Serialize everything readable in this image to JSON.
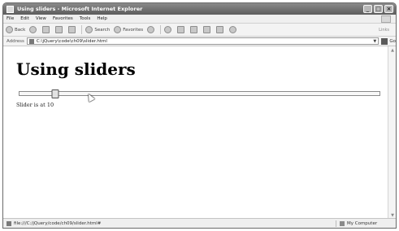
{
  "window": {
    "title": "Using sliders - Microsoft Internet Explorer",
    "controls": {
      "minimize": "_",
      "maximize": "□",
      "close": "×"
    }
  },
  "menu": {
    "items": [
      "File",
      "Edit",
      "View",
      "Favorites",
      "Tools",
      "Help"
    ]
  },
  "toolbar": {
    "back_label": "Back",
    "search_label": "Search",
    "favorites_label": "Favorites",
    "links_label": "Links"
  },
  "address": {
    "label": "Address",
    "value": "C:\\jQuery\\code\\ch09\\slider.html",
    "go_label": "Go"
  },
  "page": {
    "heading": "Using sliders",
    "slider": {
      "value": 10,
      "min": 0,
      "max": 100
    },
    "status_text": "Slider is at 10"
  },
  "statusbar": {
    "url": "file:///C:/jQuery/code/ch09/slider.html#",
    "zone": "My Computer"
  },
  "colors": {
    "titlebar": "#6e6e6e",
    "chrome": "#f0f0f0",
    "content_bg": "#ffffff"
  },
  "icons": [
    "ie-icon",
    "back-icon",
    "forward-icon",
    "stop-icon",
    "refresh-icon",
    "home-icon",
    "search-icon",
    "favorites-icon",
    "media-icon",
    "mail-icon",
    "print-icon",
    "edit-icon",
    "go-icon",
    "computer-icon"
  ]
}
